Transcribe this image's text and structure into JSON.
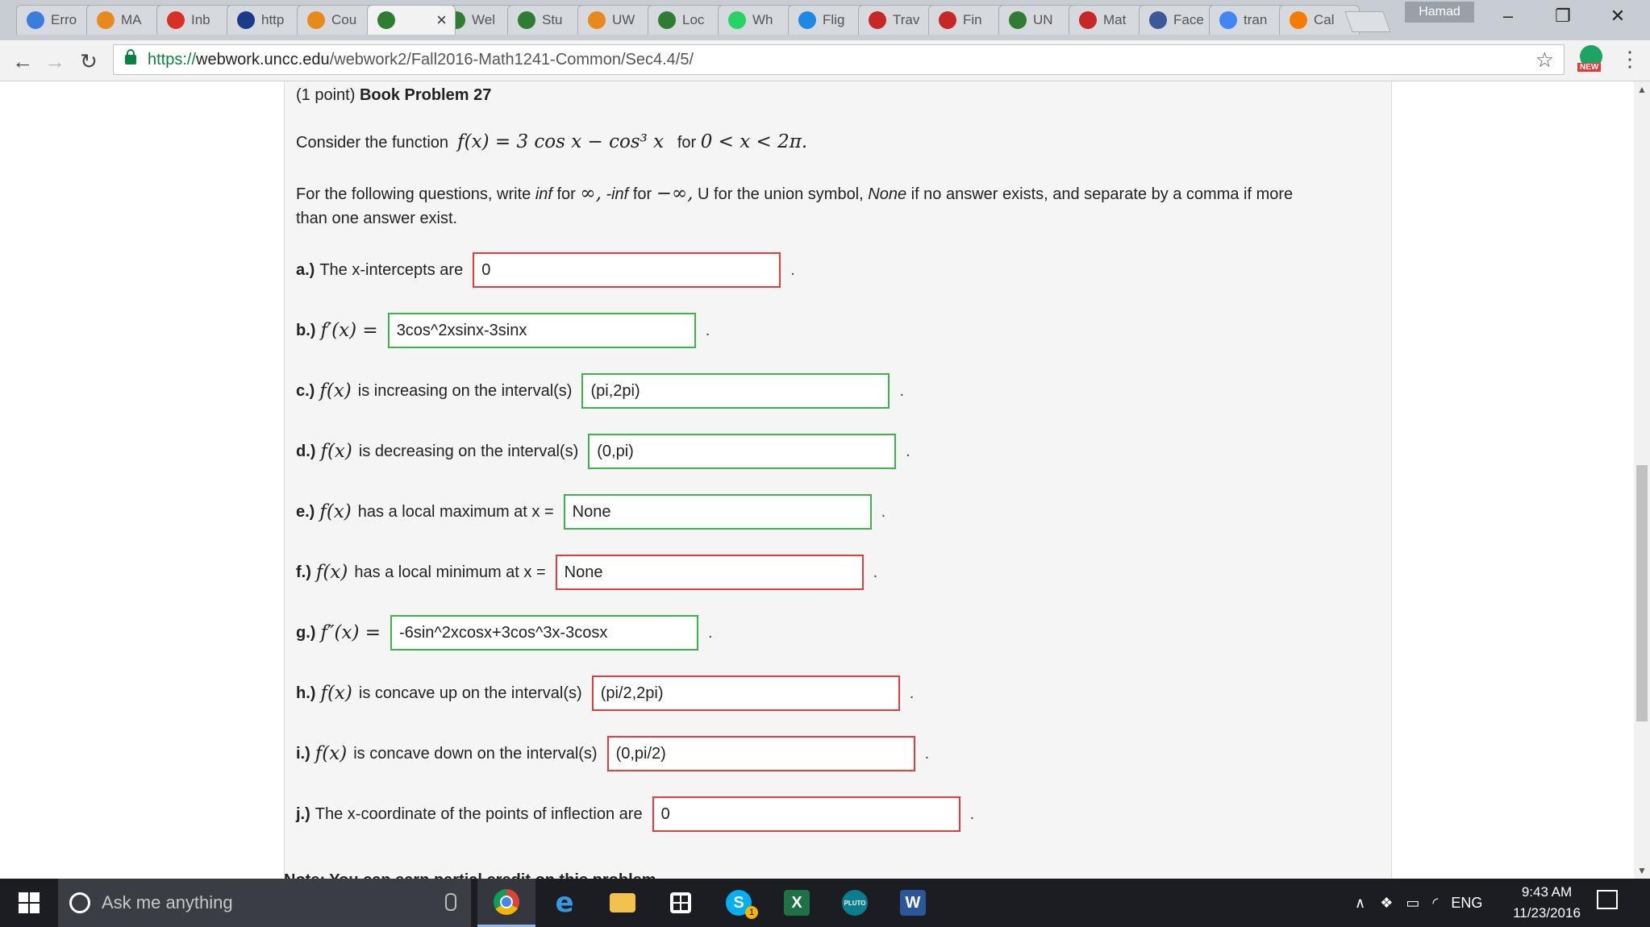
{
  "browser": {
    "tabs": [
      {
        "label": "Erro",
        "icon_color": "#3b7ddd",
        "active": false
      },
      {
        "label": "MA",
        "icon_color": "#e8891d",
        "active": false
      },
      {
        "label": "Inb",
        "icon_color": "#d93025",
        "active": false
      },
      {
        "label": "http",
        "icon_color": "#1a3a8a",
        "active": false
      },
      {
        "label": "Cou",
        "icon_color": "#e8891d",
        "active": false
      },
      {
        "label": "",
        "icon_color": "#2e7d32",
        "active": true
      },
      {
        "label": "Wel",
        "icon_color": "#2e7d32",
        "active": false
      },
      {
        "label": "Stu",
        "icon_color": "#2e7d32",
        "active": false
      },
      {
        "label": "UW",
        "icon_color": "#e8891d",
        "active": false
      },
      {
        "label": "Loc",
        "icon_color": "#2e7d32",
        "active": false
      },
      {
        "label": "Wh",
        "icon_color": "#25d366",
        "active": false
      },
      {
        "label": "Flig",
        "icon_color": "#1e88e5",
        "active": false
      },
      {
        "label": "Trav",
        "icon_color": "#c62828",
        "active": false
      },
      {
        "label": "Fin",
        "icon_color": "#c62828",
        "active": false
      },
      {
        "label": "UN",
        "icon_color": "#2e7d32",
        "active": false
      },
      {
        "label": "Mat",
        "icon_color": "#c62828",
        "active": false
      },
      {
        "label": "Face",
        "icon_color": "#3b5998",
        "active": false
      },
      {
        "label": "tran",
        "icon_color": "#4285f4",
        "active": false
      },
      {
        "label": "Cal",
        "icon_color": "#f57c00",
        "active": false
      }
    ],
    "profile_name": "Hamad",
    "url_scheme": "https://",
    "url_host": "webwork.uncc.edu",
    "url_path": "/webwork2/Fall2016-Math1241-Common/Sec4.4/5/",
    "ext_badge": "NEW"
  },
  "problem": {
    "points": "(1 point)",
    "title": "Book Problem 27",
    "consider_text": "Consider the function",
    "function_math": "f(x) = 3 cos x − cos³ x",
    "range_text": "for",
    "range_math": "0 < x < 2π.",
    "instructions_1": "For the following questions, write",
    "inf_word": "inf",
    "for_word": "for",
    "inf_symbol": "∞,",
    "neg_inf_word": "-inf",
    "neg_inf_symbol": "−∞,",
    "instructions_2": "U for the union symbol,",
    "none_word": "None",
    "instructions_3": "if no answer exists, and separate by a comma if more",
    "instructions_4": "than one answer exist."
  },
  "questions": [
    {
      "label": "a.)",
      "math": "",
      "text": "The x-intercepts are",
      "answer": "0",
      "status": "wrong"
    },
    {
      "label": "b.)",
      "math": "f′(x) =",
      "text": "",
      "answer": "3cos^2xsinx-3sinx",
      "status": "correct"
    },
    {
      "label": "c.)",
      "math": "f(x)",
      "text": "is increasing on the interval(s)",
      "answer": "(pi,2pi)",
      "status": "correct"
    },
    {
      "label": "d.)",
      "math": "f(x)",
      "text": "is decreasing on the interval(s)",
      "answer": "(0,pi)",
      "status": "correct"
    },
    {
      "label": "e.)",
      "math": "f(x)",
      "text": "has a local maximum at x =",
      "answer": "None",
      "status": "correct"
    },
    {
      "label": "f.)",
      "math": "f(x)",
      "text": "has a local minimum at x =",
      "answer": "None",
      "status": "wrong"
    },
    {
      "label": "g.)",
      "math": "f″(x) =",
      "text": "",
      "answer": "-6sin^2xcosx+3cos^3x-3cosx",
      "status": "correct"
    },
    {
      "label": "h.)",
      "math": "f(x)",
      "text": "is concave up on the interval(s)",
      "answer": "(pi/2,2pi)",
      "status": "wrong"
    },
    {
      "label": "i.)",
      "math": "f(x)",
      "text": "is concave down on the interval(s)",
      "answer": "(0,pi/2)",
      "status": "wrong"
    },
    {
      "label": "j.)",
      "math": "",
      "text": "The x-coordinate of the points of inflection are",
      "answer": "0",
      "status": "wrong"
    }
  ],
  "note_text": "Note: You can earn partial credit on this problem.",
  "taskbar": {
    "search_placeholder": "Ask me anything",
    "lang": "ENG",
    "time": "9:43 AM",
    "date": "11/23/2016",
    "skype_badge": "1"
  },
  "colors": {
    "correct_border": "#3cb44b",
    "wrong_border": "#e53b3b"
  }
}
